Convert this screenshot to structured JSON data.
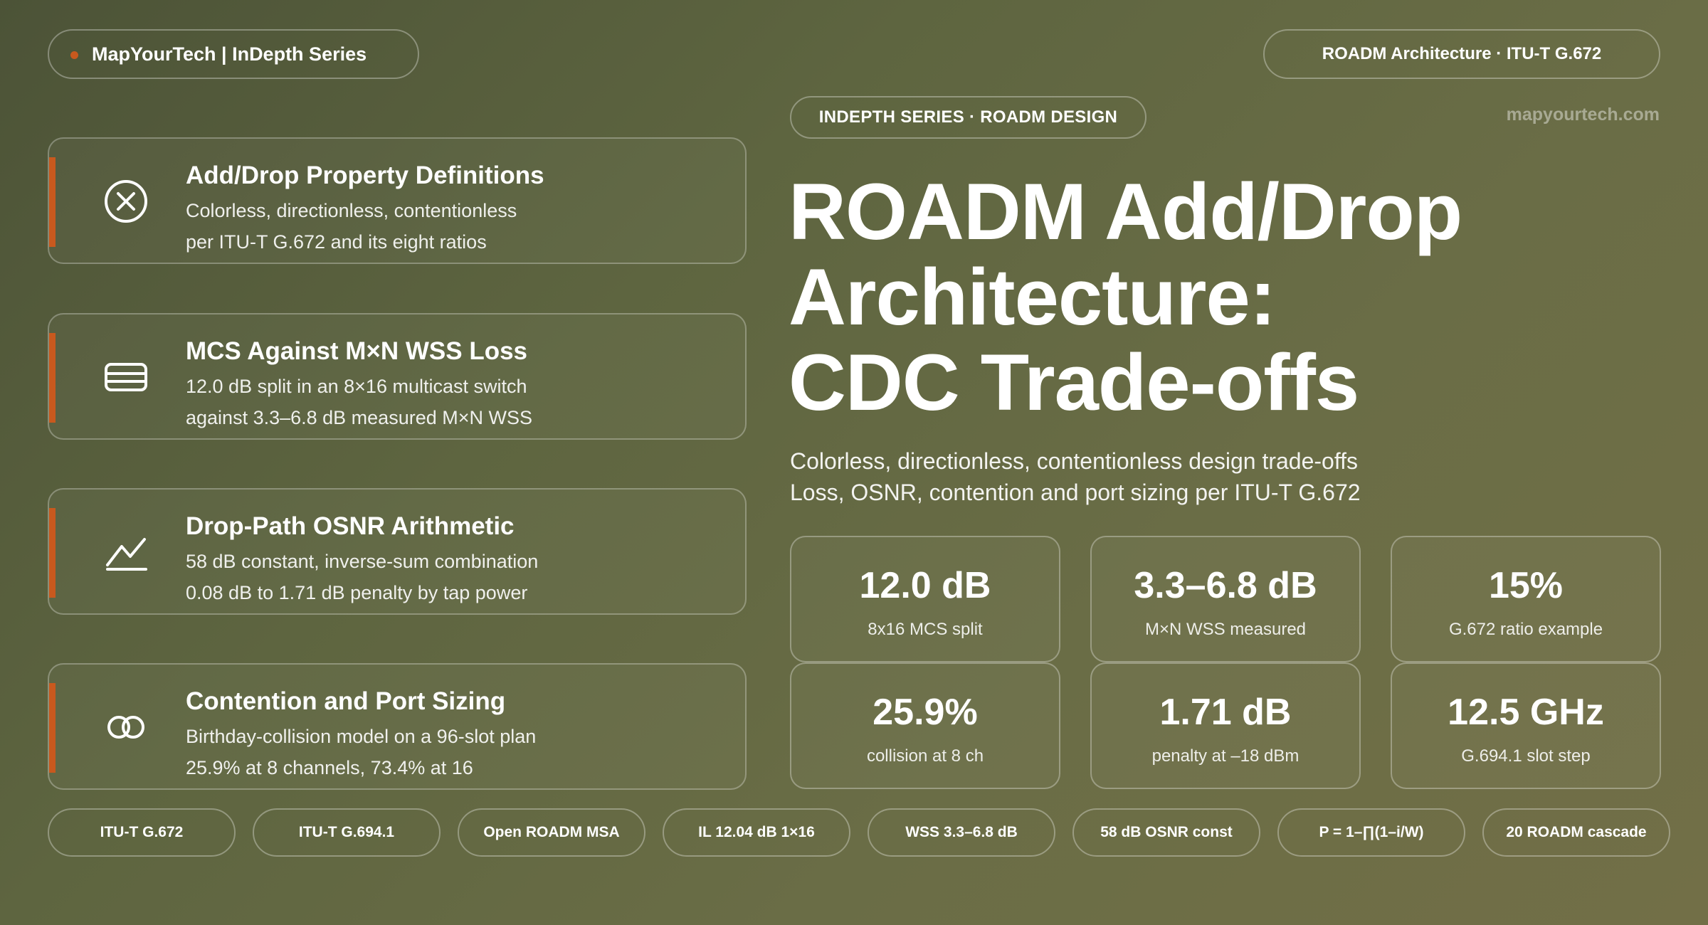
{
  "header": {
    "brand": "MapYourTech | InDepth Series",
    "topic": "ROADM Architecture · ITU-T G.672",
    "series": "INDEPTH SERIES · ROADM DESIGN",
    "domain": "mapyourtech.com"
  },
  "accent_color": "#c8591e",
  "cards": [
    {
      "icon": "close-circle-icon",
      "title": "Add/Drop Property Definitions",
      "line1": "Colorless, directionless, contentionless",
      "line2": "per ITU-T G.672 and its eight ratios"
    },
    {
      "icon": "stacked-card-icon",
      "title": "MCS Against M×N WSS Loss",
      "line1": "12.0 dB split in an 8×16 multicast switch",
      "line2": "against 3.3–6.8 dB measured M×N WSS"
    },
    {
      "icon": "line-chart-icon",
      "title": "Drop-Path OSNR Arithmetic",
      "line1": "58 dB constant, inverse-sum combination",
      "line2": "0.08 dB to 1.71 dB penalty by tap power"
    },
    {
      "icon": "overlapping-rings-icon",
      "title": "Contention and Port Sizing",
      "line1": "Birthday-collision model on a 96-slot plan",
      "line2": "25.9% at 8 channels, 73.4% at 16"
    }
  ],
  "title": {
    "line1": "ROADM Add/Drop",
    "line2": "Architecture:",
    "line3": "CDC Trade-offs"
  },
  "subtitle": {
    "line1": "Colorless, directionless, contentionless design trade-offs",
    "line2": "Loss, OSNR, contention and port sizing per ITU-T G.672"
  },
  "stats": [
    {
      "value": "12.0 dB",
      "label": "8x16 MCS split"
    },
    {
      "value": "3.3–6.8 dB",
      "label": "M×N WSS measured"
    },
    {
      "value": "15%",
      "label": "G.672 ratio example"
    },
    {
      "value": "25.9%",
      "label": "collision at 8 ch"
    },
    {
      "value": "1.71 dB",
      "label": "penalty at –18 dBm"
    },
    {
      "value": "12.5 GHz",
      "label": "G.694.1 slot step"
    }
  ],
  "tags": [
    "ITU-T G.672",
    "ITU-T G.694.1",
    "Open ROADM MSA",
    "IL 12.04 dB 1×16",
    "WSS 3.3–6.8 dB",
    "58 dB OSNR const",
    "P = 1–∏(1–i/W)",
    "20 ROADM cascade"
  ]
}
